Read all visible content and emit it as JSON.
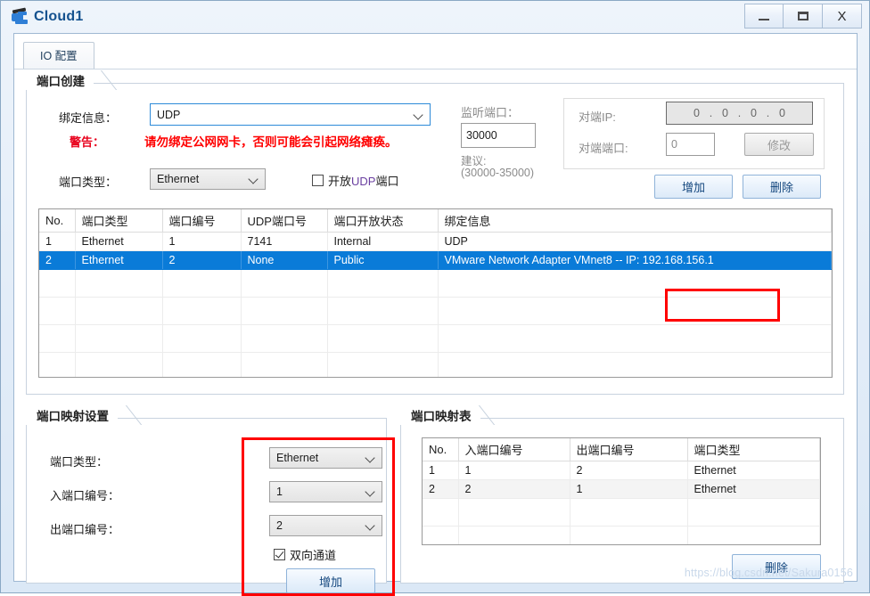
{
  "window": {
    "title": "Cloud1",
    "icon": "cloud-device-icon",
    "controls": {
      "minimize": "_",
      "maximize": "□",
      "close": "X"
    }
  },
  "tabs": [
    {
      "label": "IO 配置",
      "active": true
    }
  ],
  "port_create": {
    "title": "端口创建",
    "bind_info_label": "绑定信息：",
    "bind_info_value": "UDP",
    "warning_label": "警告：",
    "warning_text": "请勿绑定公网网卡，否则可能会引起网络瘫痪。",
    "port_type_label": "端口类型：",
    "port_type_value": "Ethernet",
    "open_udp_label_pre": "开放",
    "open_udp_label_mid": "UDP",
    "open_udp_label_post": "端口",
    "open_udp_checked": false,
    "listen_port_label": "监听端口：",
    "listen_port_value": "30000",
    "suggest_label": "建议:",
    "suggest_range": "(30000-35000)",
    "peer_ip_label": "对端IP:",
    "peer_ip_octets": [
      "0",
      "0",
      "0",
      "0"
    ],
    "peer_port_label": "对端端口:",
    "peer_port_value": "0",
    "modify_button": "修改",
    "add_button": "增加",
    "delete_button": "删除"
  },
  "port_table": {
    "columns": [
      "No.",
      "端口类型",
      "端口编号",
      "UDP端口号",
      "端口开放状态",
      "绑定信息"
    ],
    "rows": [
      {
        "no": "1",
        "type": "Ethernet",
        "num": "1",
        "udp": "7141",
        "state": "Internal",
        "bind": "UDP",
        "selected": false
      },
      {
        "no": "2",
        "type": "Ethernet",
        "num": "2",
        "udp": "None",
        "state": "Public",
        "bind": "VMware Network Adapter VMnet8 -- IP: 192.168.156.1",
        "selected": true
      }
    ],
    "empty_rows": 5
  },
  "mapping_settings": {
    "title": "端口映射设置",
    "port_type_label": "端口类型：",
    "port_type_value": "Ethernet",
    "in_port_label": "入端口编号：",
    "in_port_value": "1",
    "out_port_label": "出端口编号：",
    "out_port_value": "2",
    "bidirectional_label": "双向通道",
    "bidirectional_checked": true,
    "add_button": "增加"
  },
  "mapping_table": {
    "title": "端口映射表",
    "columns": [
      "No.",
      "入端口编号",
      "出端口编号",
      "端口类型"
    ],
    "rows": [
      {
        "no": "1",
        "in": "1",
        "out": "2",
        "type": "Ethernet"
      },
      {
        "no": "2",
        "in": "2",
        "out": "1",
        "type": "Ethernet"
      }
    ],
    "empty_rows": 3,
    "delete_button": "删除"
  },
  "annotations": {
    "highlight_color": "#ff0000"
  },
  "watermark": {
    "text": "https://blog.csdn.net/Sakura0156"
  }
}
